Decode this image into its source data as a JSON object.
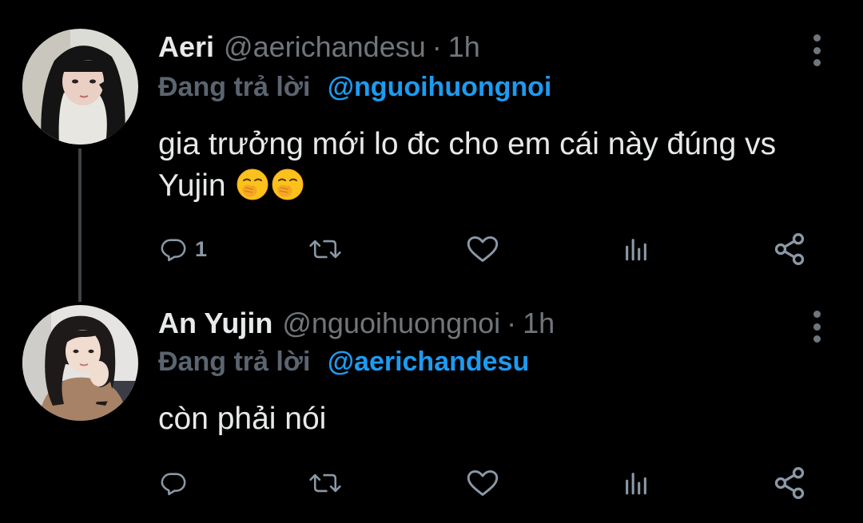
{
  "tweets": [
    {
      "name": "Aeri",
      "handle": "@aerichandesu",
      "separator": "·",
      "time": "1h",
      "replying_label": "Đang trả lời",
      "replying_to": "@nguoihuongnoi",
      "text": "gia trưởng mới lo đc cho em cái này đúng vs Yujin",
      "emojis": [
        "yawning-face-emoji",
        "yawning-face-emoji"
      ],
      "reply_count": "1",
      "retweet_count": "",
      "like_count": ""
    },
    {
      "name": "An Yujin",
      "handle": "@nguoihuongnoi",
      "separator": "·",
      "time": "1h",
      "replying_label": "Đang trả lời",
      "replying_to": "@aerichandesu",
      "text": "còn phải nói",
      "emojis": [],
      "reply_count": "",
      "retweet_count": "",
      "like_count": ""
    }
  ],
  "icons": [
    "reply-icon",
    "retweet-icon",
    "heart-icon",
    "views-icon",
    "share-icon",
    "more-icon"
  ],
  "colors": {
    "background": "#000000",
    "text": "#e7e9ea",
    "secondary": "#71767b",
    "link": "#1d9bf0",
    "thread_line": "#3d4247"
  }
}
